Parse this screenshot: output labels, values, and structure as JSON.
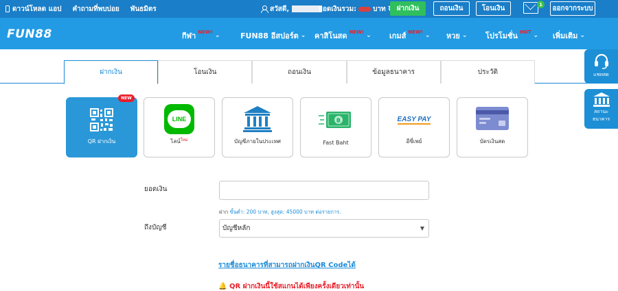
{
  "topbar": {
    "download_app": "ดาวน์โหลด แอป",
    "faq": "คำถามที่พบบ่อย",
    "affiliate": "พันธมิตร",
    "greeting": "สวัสดี,",
    "balance_label": "ยอดเงินรวม:",
    "currency": "บาท",
    "deposit_button": "ฝากเงิน",
    "withdraw_button": "ถอนเงิน",
    "transfer_button": "โอนเงิน",
    "mail_count": "1",
    "logout_button": "ออกจากระบบ"
  },
  "nav": {
    "logo": "FUN88",
    "items": [
      {
        "label": "กีฬา",
        "badge": "NEW!"
      },
      {
        "label": "FUN88 อีสปอร์ต",
        "badge": ""
      },
      {
        "label": "คาสิโนสด",
        "badge": "NEW!"
      },
      {
        "label": "เกมส์",
        "badge": "NEW!"
      },
      {
        "label": "หวย",
        "badge": ""
      },
      {
        "label": "โปรโมชั่น",
        "badge": "HOT"
      },
      {
        "label": "เพิ่มเติม",
        "badge": ""
      }
    ]
  },
  "float": {
    "chat_label": "แชทสด",
    "bank_label_1": "สถานะ",
    "bank_label_2": "ธนาคาร"
  },
  "tabs": [
    "ฝากเงิน",
    "โอนเงิน",
    "ถอนเงิน",
    "ข้อมูลธนาคาร",
    "ประวัติ"
  ],
  "methods": [
    {
      "label": "QR ฝากเงิน",
      "badge": "NEW"
    },
    {
      "label": "ไลน์",
      "mini": "ใหม่"
    },
    {
      "label": "บัญชีภายในประเทศ"
    },
    {
      "label": "Fast Baht"
    },
    {
      "label": "อีซี่เพย์"
    },
    {
      "label": "บัตรเงินสด"
    }
  ],
  "line_logo_text": "LINE",
  "easypay_logo_text": "EASY PAY",
  "form": {
    "amount_label": "ยอดเงิน",
    "amount_value": "",
    "hint_prefix": "ฝาก",
    "hint_limits": "ขั้นต่ำ: 200 บาท, สูงสุด: 45000 บาท ต่อรายการ.",
    "account_label": "ถึงบัญชี",
    "account_value": "บัญชีหลัก"
  },
  "links": {
    "supported_banks": "รายชื่อธนาคารที่สามารถฝากเงินQR Codeได้",
    "warning": "QR ฝากเงินนี้ใช้สแกนได้เพียงครั้งเดียวเท่านั้น"
  },
  "colors": {
    "topbar": "#1a7ec8",
    "navbar": "#229be4",
    "accent": "#1a8bd8",
    "deposit_green": "#2fbf5d",
    "alert_red": "#e8202a"
  }
}
